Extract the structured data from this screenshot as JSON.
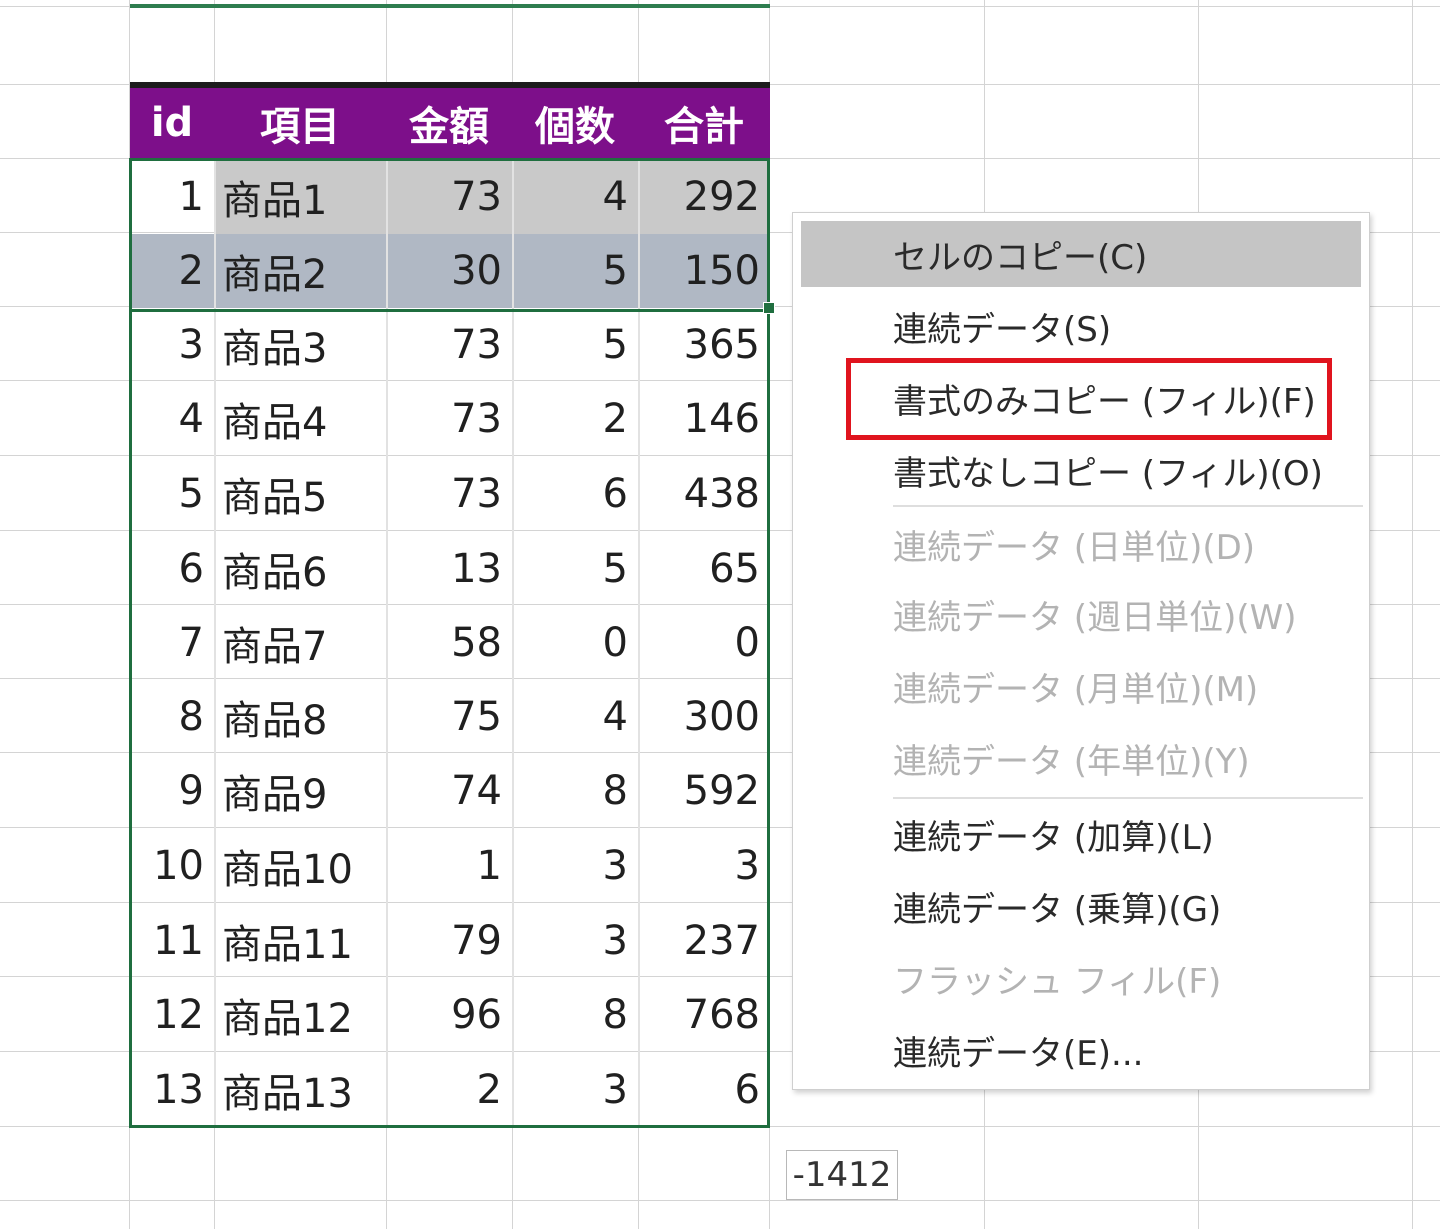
{
  "columns": [
    "id",
    "項目",
    "金額",
    "個数",
    "合計"
  ],
  "rows": [
    {
      "id": "1",
      "item": "商品1",
      "amount": "73",
      "qty": "4",
      "total": "292"
    },
    {
      "id": "2",
      "item": "商品2",
      "amount": "30",
      "qty": "5",
      "total": "150"
    },
    {
      "id": "3",
      "item": "商品3",
      "amount": "73",
      "qty": "5",
      "total": "365"
    },
    {
      "id": "4",
      "item": "商品4",
      "amount": "73",
      "qty": "2",
      "total": "146"
    },
    {
      "id": "5",
      "item": "商品5",
      "amount": "73",
      "qty": "6",
      "total": "438"
    },
    {
      "id": "6",
      "item": "商品6",
      "amount": "13",
      "qty": "5",
      "total": "65"
    },
    {
      "id": "7",
      "item": "商品7",
      "amount": "58",
      "qty": "0",
      "total": "0"
    },
    {
      "id": "8",
      "item": "商品8",
      "amount": "75",
      "qty": "4",
      "total": "300"
    },
    {
      "id": "9",
      "item": "商品9",
      "amount": "74",
      "qty": "8",
      "total": "592"
    },
    {
      "id": "10",
      "item": "商品10",
      "amount": "1",
      "qty": "3",
      "total": "3"
    },
    {
      "id": "11",
      "item": "商品11",
      "amount": "79",
      "qty": "3",
      "total": "237"
    },
    {
      "id": "12",
      "item": "商品12",
      "amount": "96",
      "qty": "8",
      "total": "768"
    },
    {
      "id": "13",
      "item": "商品13",
      "amount": "2",
      "qty": "3",
      "total": "6"
    }
  ],
  "context_menu": {
    "items": [
      {
        "label": "セルのコピー(C)",
        "state": "hover"
      },
      {
        "label": "連続データ(S)",
        "state": "enabled"
      },
      {
        "label": "書式のみコピー (フィル)(F)",
        "state": "highlighted"
      },
      {
        "label": "書式なしコピー (フィル)(O)",
        "state": "enabled"
      },
      {
        "label": "連続データ (日単位)(D)",
        "state": "disabled"
      },
      {
        "label": "連続データ (週日単位)(W)",
        "state": "disabled"
      },
      {
        "label": "連続データ (月単位)(M)",
        "state": "disabled"
      },
      {
        "label": "連続データ (年単位)(Y)",
        "state": "disabled"
      },
      {
        "label": "連続データ (加算)(L)",
        "state": "enabled"
      },
      {
        "label": "連続データ (乗算)(G)",
        "state": "enabled"
      },
      {
        "label": "フラッシュ フィル(F)",
        "state": "disabled"
      },
      {
        "label": "連続データ(E)...",
        "state": "enabled"
      }
    ]
  },
  "fill_tooltip": "-1412",
  "colors": {
    "header_bg": "#7d0f8a",
    "header_text": "#ffffff",
    "selection_border": "#1f6e3f",
    "highlight_box": "#e0141e",
    "row1_fill": "#c9c9c9",
    "row2_fill": "#b0b8c4"
  }
}
